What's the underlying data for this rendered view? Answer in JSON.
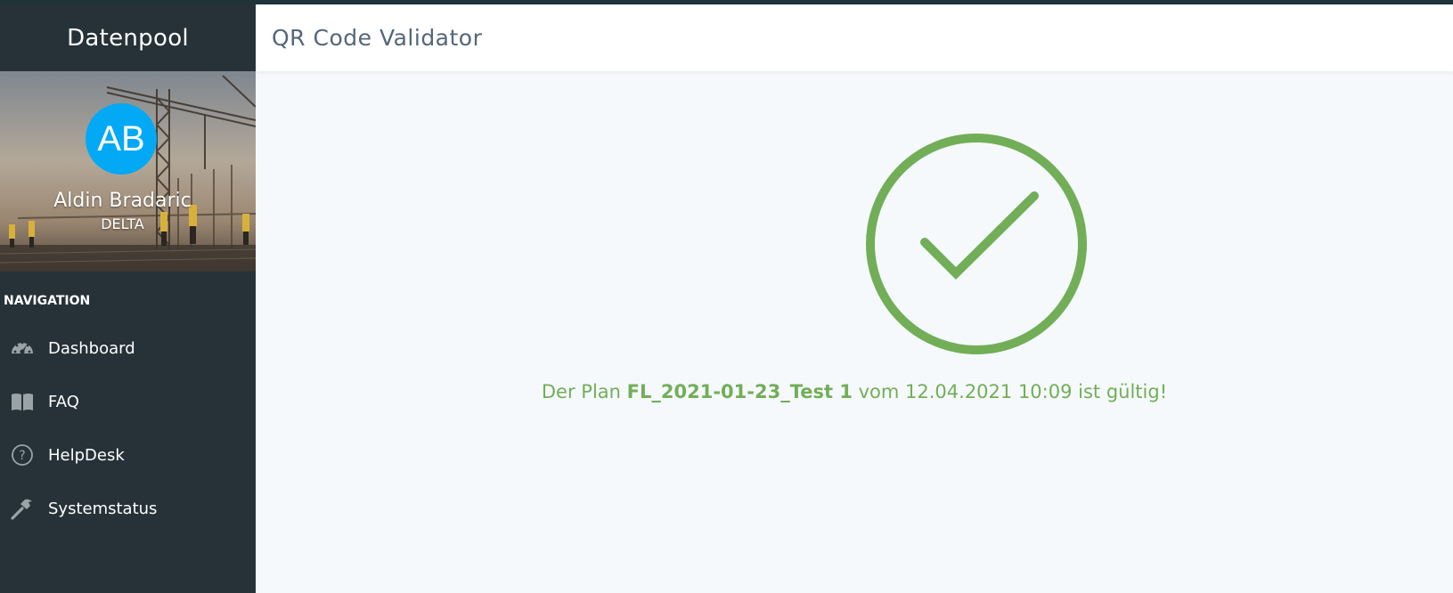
{
  "app": {
    "brand": "Datenpool"
  },
  "user": {
    "initials": "AB",
    "name": "Aldin Bradaric",
    "org": "DELTA"
  },
  "sidebar": {
    "heading": "NAVIGATION",
    "items": [
      {
        "label": "Dashboard",
        "icon": "dashboard-gauge-icon"
      },
      {
        "label": "FAQ",
        "icon": "book-icon"
      },
      {
        "label": "HelpDesk",
        "icon": "help-circle-icon"
      },
      {
        "label": "Systemstatus",
        "icon": "hammer-icon"
      }
    ]
  },
  "header": {
    "title": "QR Code Validator"
  },
  "result": {
    "status": "valid",
    "icon": "checkmark-circle-icon",
    "prefix": "Der Plan ",
    "plan_name": "FL_2021-01-23_Test 1",
    "middle": " vom ",
    "datetime": "12.04.2021 10:09",
    "suffix": " ist gültig!"
  },
  "colors": {
    "sidebar_bg": "#263238",
    "avatar_bg": "#03a9f4",
    "success": "#72ae57",
    "title_text": "#54667a",
    "main_bg": "#f5f9fc"
  }
}
